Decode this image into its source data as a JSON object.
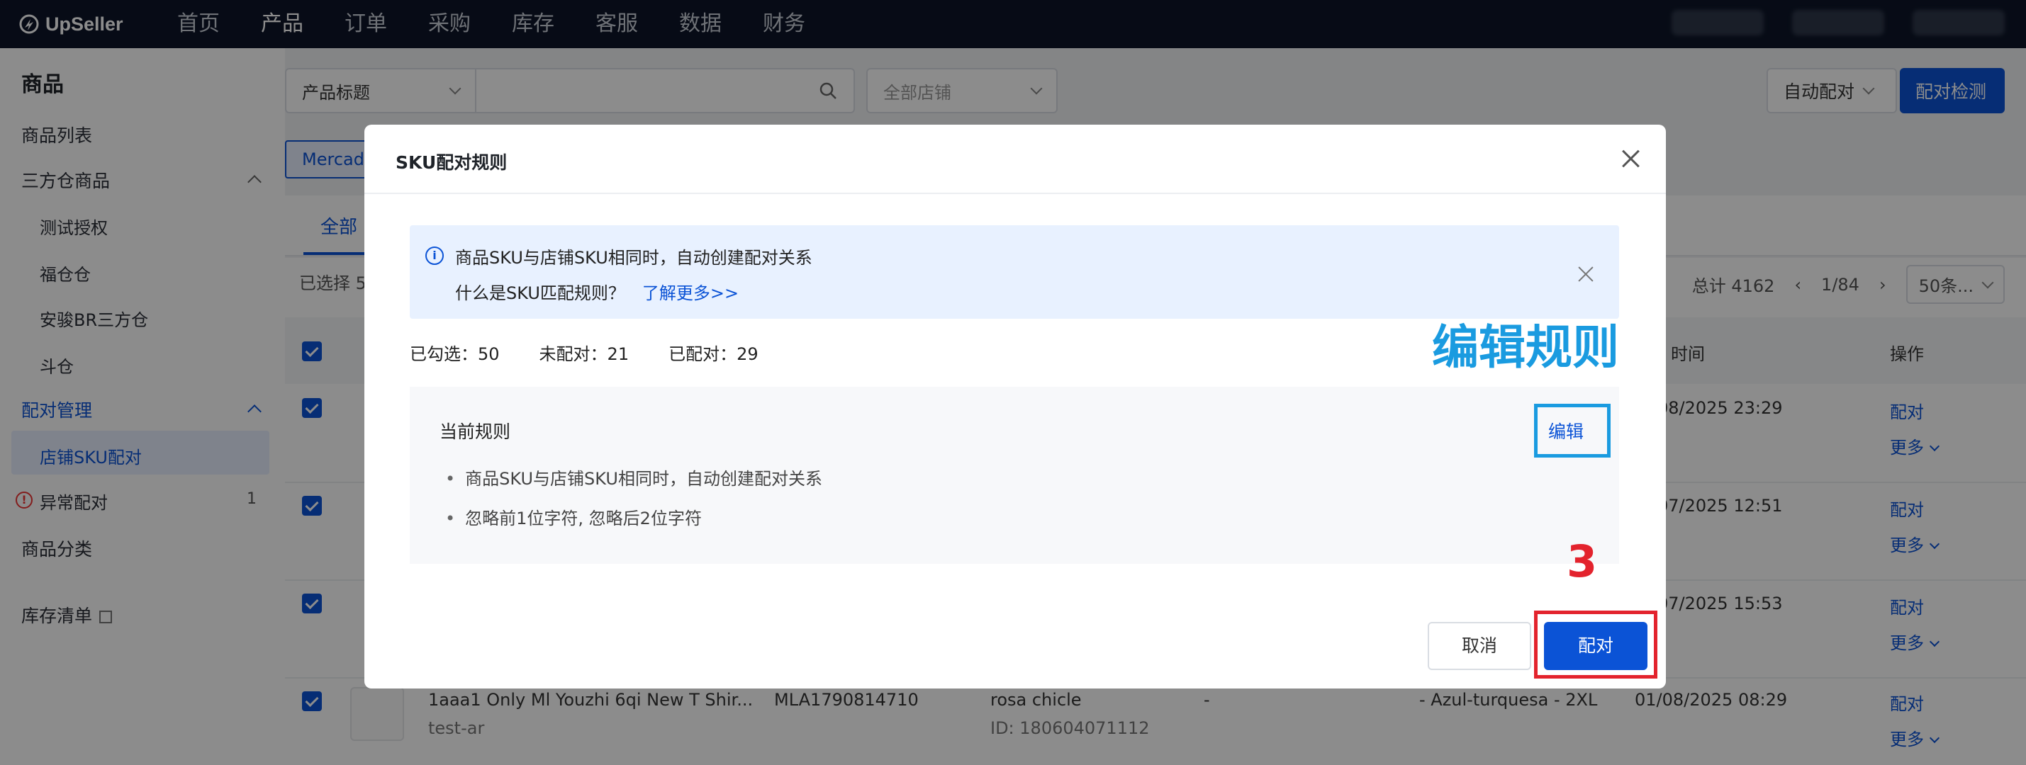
{
  "app": {
    "logo_text": "UpSeller"
  },
  "nav": {
    "items": [
      "首页",
      "产品",
      "订单",
      "采购",
      "库存",
      "客服",
      "数据",
      "财务"
    ],
    "active": "产品"
  },
  "sidebar": {
    "title": "商品",
    "items": {
      "product_list": "商品列表",
      "third_party_wh": "三方仓商品",
      "test_auth": "测试授权",
      "fu_wh": "福仓仓",
      "anjun_br": "安骏BR三方仓",
      "dou_wh": "斗仓",
      "pairing_mgmt": "配对管理",
      "store_sku_pairing": "店铺SKU配对",
      "abnormal_pairing": "异常配对",
      "abnormal_count": "1",
      "category": "商品分类",
      "inventory_list": "库存清单"
    }
  },
  "toolbar": {
    "title_select": "产品标题",
    "store_select": "全部店铺",
    "auto_pair": "自动配对",
    "pair_check": "配对检测"
  },
  "platform_tag": "Mercado",
  "tabs": {
    "all": "全部"
  },
  "table": {
    "selected_prefix": "已选择 5",
    "total": "总计 4162",
    "page": "1/84",
    "page_size": "50条...",
    "headers": {
      "time": "时间",
      "action": "操作"
    },
    "rows": [
      {
        "time": "08/2025 23:29",
        "action": "配对",
        "more": "更多"
      },
      {
        "time": "07/2025 12:51",
        "action": "配对",
        "more": "更多"
      },
      {
        "time": "07/2025 15:53",
        "action": "配对",
        "more": "更多"
      },
      {
        "title": "1aaa1 Only Ml Youzhi 6qi New T Shir...",
        "sub": "test-ar",
        "item_id": "MLA1790814710",
        "store": "rosa chicle",
        "store_id": "ID: 180604071112",
        "dash": "-",
        "variant": "- Azul-turquesa - 2XL",
        "time": "01/08/2025 08:29",
        "action": "配对",
        "more": "更多"
      }
    ]
  },
  "modal": {
    "title": "SKU配对规则",
    "info_line1": "商品SKU与店铺SKU相同时，自动创建配对关系",
    "info_line2": "什么是SKU匹配规则？",
    "info_link": "了解更多>>",
    "stats": {
      "selected": "已勾选：50",
      "unpaired": "未配对：21",
      "paired": "已配对：29"
    },
    "annotation_edit": "编辑规则",
    "rule_title": "当前规则",
    "rules": [
      "商品SKU与店铺SKU相同时，自动创建配对关系",
      "忽略前1位字符, 忽略后2位字符"
    ],
    "edit": "编辑",
    "annotation_step": "3",
    "cancel": "取消",
    "confirm": "配对"
  },
  "colors": {
    "primary": "#0b53d6",
    "annotation_blue": "#1a9be0",
    "annotation_red": "#e3232d",
    "nav_bg": "#0d1528"
  }
}
